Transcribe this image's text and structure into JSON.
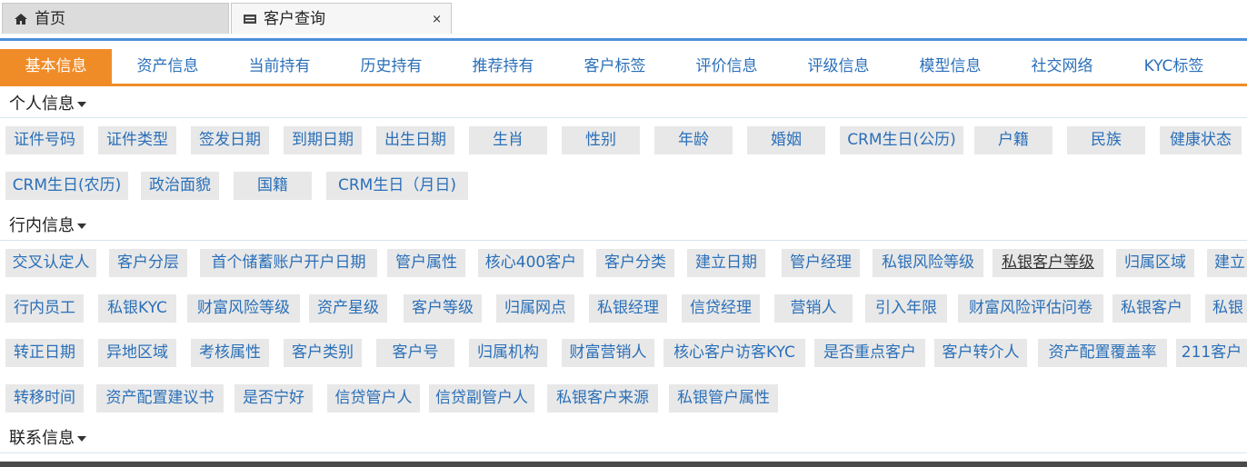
{
  "window_tabs": {
    "home_label": "首页",
    "query_label": "客户查询",
    "close_glyph": "×"
  },
  "nav_tabs": [
    "基本信息",
    "资产信息",
    "当前持有",
    "历史持有",
    "推荐持有",
    "客户标签",
    "评价信息",
    "评级信息",
    "模型信息",
    "社交网络",
    "KYC标签"
  ],
  "active_nav": "基本信息",
  "accent_color": "#f08c28",
  "link_color": "#2a6fb8",
  "sections": {
    "personal": {
      "title": "个人信息",
      "rows": [
        [
          "证件号码",
          "证件类型",
          "签发日期",
          "到期日期",
          "出生日期",
          "生肖",
          "性别",
          "年龄",
          "婚姻",
          "CRM生日(公历)",
          "户籍",
          "民族",
          "健康状态"
        ],
        [
          "CRM生日(农历)",
          "政治面貌",
          "国籍",
          "CRM生日（月日)"
        ]
      ]
    },
    "bank": {
      "title": "行内信息",
      "rows": [
        [
          "交叉认定人",
          "客户分层",
          "首个储蓄账户开户日期",
          "管户属性",
          "核心400客户",
          "客户分类",
          "建立日期",
          "管户经理",
          "私银风险等级",
          "私银客户等级",
          "归属区域",
          "建立"
        ],
        [
          "行内员工",
          "私银KYC",
          "财富风险等级",
          "资产星级",
          "客户等级",
          "归属网点",
          "私银经理",
          "信贷经理",
          "营销人",
          "引入年限",
          "财富风险评估问卷",
          "私银客户",
          "私银"
        ],
        [
          "转正日期",
          "异地区域",
          "考核属性",
          "客户类别",
          "客户号",
          "归属机构",
          "财富营销人",
          "核心客户访客KYC",
          "是否重点客户",
          "客户转介人",
          "资产配置覆盖率",
          "211客户"
        ],
        [
          "转移时间",
          "资产配置建议书",
          "是否宁好",
          "信贷管户人",
          "信贷副管户人",
          "私银客户来源",
          "私银管户属性"
        ]
      ]
    },
    "contact": {
      "title": "联系信息"
    }
  }
}
